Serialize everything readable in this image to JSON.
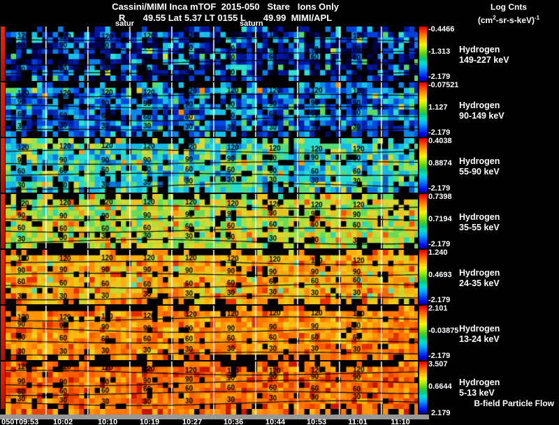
{
  "header": {
    "title": "Cassini/MIMI Inca mTOF  2015-050   Stare   Ions Only",
    "subtitle": "R       49.55 Lat 5.37 LT 0155 L       49.99  MIMI/APL",
    "colorbar_title": {
      "line1": "Log Cnts",
      "unit_prefix": "(cm",
      "unit_sup1": "2",
      "unit_mid": "-sr-s-keV)",
      "unit_sup2": "-1"
    }
  },
  "annotations": {
    "left_marker": "satur",
    "right_marker": "saturn"
  },
  "bfield_label": "B-field Particle Flow",
  "time_axis": {
    "labels": [
      "050T09:53",
      "10:02",
      "10:10",
      "10:19",
      "10:27",
      "10:36",
      "10:44",
      "10:53",
      "11:01",
      "11:10"
    ]
  },
  "chart_data": {
    "type": "heatmap",
    "title": "Cassini/MIMI Inca mTOF 2015-050 Stare Ions Only",
    "instrument": "MIMI/APL",
    "x_labels": [
      "050T09:53",
      "10:02",
      "10:10",
      "10:19",
      "10:27",
      "10:36",
      "10:44",
      "10:53",
      "11:01",
      "11:10"
    ],
    "colorbar_units": "Log Cnts (cm2-sr-s-keV)-1",
    "contour_levels": [
      120,
      90,
      60,
      30
    ],
    "grid": true,
    "legend_position": "right",
    "panels": [
      {
        "species": "Hydrogen",
        "energy": "149-227 keV",
        "cb_top": "-0.4466",
        "cb_mid": "-1.313",
        "cb_bot": "-2.179",
        "top_black": 0.5,
        "bot_black": 0.25,
        "dark_bias": 0.5,
        "dark": [
          "#000000",
          "#000048",
          "#001488"
        ],
        "palette": [
          [
            "#000050",
            2
          ],
          [
            "#0018a0",
            2.6
          ],
          [
            "#0040d8",
            2.2
          ],
          [
            "#0b7fe8",
            1.6
          ],
          [
            "#18c0e8",
            1.6
          ],
          [
            "#30e0d0",
            1.0
          ],
          [
            "#58d868",
            0.5
          ],
          [
            "#c8e838",
            0.15
          ],
          [
            "#000000",
            2.4
          ]
        ]
      },
      {
        "species": "Hydrogen",
        "energy": "90-149 keV",
        "cb_top": "-0.07521",
        "cb_mid": "1.127",
        "cb_bot": "-2.179",
        "top_black": 0.5,
        "bot_black": 0.2,
        "dark_bias": 0.32,
        "dark": [
          "#000000",
          "#000c60",
          "#0030b0"
        ],
        "palette": [
          [
            "#0020b0",
            2
          ],
          [
            "#0048e0",
            2.5
          ],
          [
            "#0b88e8",
            2.2
          ],
          [
            "#18c0e8",
            2.0
          ],
          [
            "#30e0c8",
            1.2
          ],
          [
            "#60d860",
            0.6
          ],
          [
            "#e0d030",
            0.2
          ],
          [
            "#ff8800",
            0.1
          ],
          [
            "#000000",
            1.7
          ]
        ]
      },
      {
        "species": "Hydrogen",
        "energy": "55-90 keV",
        "cb_top": "0.4038",
        "cb_mid": "0.8874",
        "cb_bot": "-2.179",
        "top_black": 0.45,
        "bot_black": 0.18,
        "dark_bias": 0.16,
        "dark": [
          "#000000",
          "#0b60c0"
        ],
        "palette": [
          [
            "#0878e0",
            1
          ],
          [
            "#18b8e8",
            2.5
          ],
          [
            "#28dcd0",
            2.6
          ],
          [
            "#58dc78",
            2.0
          ],
          [
            "#a0e048",
            1.5
          ],
          [
            "#d8d838",
            1.0
          ],
          [
            "#ff9911",
            0.3
          ],
          [
            "#000000",
            1.1
          ]
        ]
      },
      {
        "species": "Hydrogen",
        "energy": "35-55 keV",
        "cb_top": "0.7398",
        "cb_mid": "0.7194",
        "cb_bot": "-2.179",
        "top_black": 0.42,
        "bot_black": 0.2,
        "dark_bias": 0.06,
        "dark": [
          "#000000"
        ],
        "palette": [
          [
            "#30d8b0",
            1
          ],
          [
            "#68dc58",
            2
          ],
          [
            "#a8e040",
            2.6
          ],
          [
            "#d8d830",
            2.6
          ],
          [
            "#f0c020",
            1.6
          ],
          [
            "#ff9911",
            0.8
          ],
          [
            "#ff5500",
            0.3
          ],
          [
            "#000000",
            0.9
          ]
        ]
      },
      {
        "species": "Hydrogen",
        "energy": "24-35 keV",
        "cb_top": "1.240",
        "cb_mid": "0.4693",
        "cb_bot": "-2.179",
        "top_black": 0.38,
        "bot_black": 0.3,
        "dark_bias": 0.0,
        "dark": [
          "#000000"
        ],
        "palette": [
          [
            "#c8d830",
            1
          ],
          [
            "#ecc81c",
            2.6
          ],
          [
            "#ffae10",
            2.6
          ],
          [
            "#ff8c08",
            2.0
          ],
          [
            "#ff6600",
            1.0
          ],
          [
            "#e83000",
            0.6
          ],
          [
            "#60dca0",
            0.4
          ],
          [
            "#000000",
            0.9
          ]
        ]
      },
      {
        "species": "Hydrogen",
        "energy": "13-24 keV",
        "cb_top": "2.101",
        "cb_mid": "-0.03875",
        "cb_bot": "-2.179",
        "top_black": 0.32,
        "bot_black": 0.3,
        "dark_bias": 0.0,
        "dark": [
          "#000000"
        ],
        "palette": [
          [
            "#ffb810",
            2
          ],
          [
            "#ff9408",
            2.6
          ],
          [
            "#ff7800",
            2.6
          ],
          [
            "#ff5c00",
            1.6
          ],
          [
            "#e03000",
            0.8
          ],
          [
            "#f0d020",
            0.8
          ],
          [
            "#000000",
            0.7
          ]
        ]
      },
      {
        "species": "Hydrogen",
        "energy": "5-13 keV",
        "cb_top": "3.507",
        "cb_mid": "0.6644",
        "cb_bot": "2.179",
        "top_black": 0.32,
        "bot_black": 0.3,
        "dark_bias": 0.0,
        "dark": [
          "#000000"
        ],
        "palette": [
          [
            "#ff9408",
            2
          ],
          [
            "#ff7800",
            2.6
          ],
          [
            "#ff5c00",
            2.4
          ],
          [
            "#e84400",
            1.6
          ],
          [
            "#c81800",
            1.0
          ],
          [
            "#ffb810",
            1.0
          ],
          [
            "#000000",
            0.8
          ]
        ]
      }
    ],
    "bfield_palette": [
      [
        "#ff7800",
        2.5
      ],
      [
        "#e84400",
        2.0
      ],
      [
        "#c81800",
        1.5
      ],
      [
        "#ffb810",
        1.5
      ],
      [
        "#000000",
        1.6
      ],
      [
        "#ff9408",
        2.0
      ]
    ],
    "accent_colors": {
      "grid_line": "#ffffff",
      "contour_line": "#000000",
      "axis_bar": "#989898",
      "left_edge": "#d81c00"
    }
  }
}
